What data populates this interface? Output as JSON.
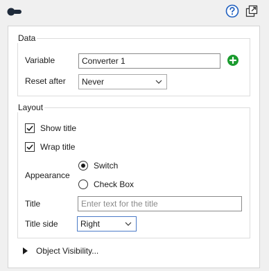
{
  "data_group": {
    "legend": "Data",
    "variable_label": "Variable",
    "variable_value": "Converter 1",
    "reset_after_label": "Reset after",
    "reset_after_value": "Never"
  },
  "layout_group": {
    "legend": "Layout",
    "show_title_label": "Show title",
    "show_title_checked": true,
    "wrap_title_label": "Wrap title",
    "wrap_title_checked": true,
    "appearance_label": "Appearance",
    "appearance_options": [
      "Switch",
      "Check Box"
    ],
    "appearance_selected": "Switch",
    "title_label": "Title",
    "title_value": "",
    "title_placeholder": "Enter text for the title",
    "title_side_label": "Title side",
    "title_side_value": "Right"
  },
  "object_visibility_label": "Object Visibility...",
  "icons": {
    "toggle": "toggle-switch-icon",
    "help": "help-icon",
    "popout": "popout-icon",
    "add": "add-icon",
    "expand": "expand-triangle-icon"
  },
  "colors": {
    "help_blue": "#1f5fbf",
    "add_green": "#1a9b2e",
    "focus_border": "#4a7ac7"
  }
}
